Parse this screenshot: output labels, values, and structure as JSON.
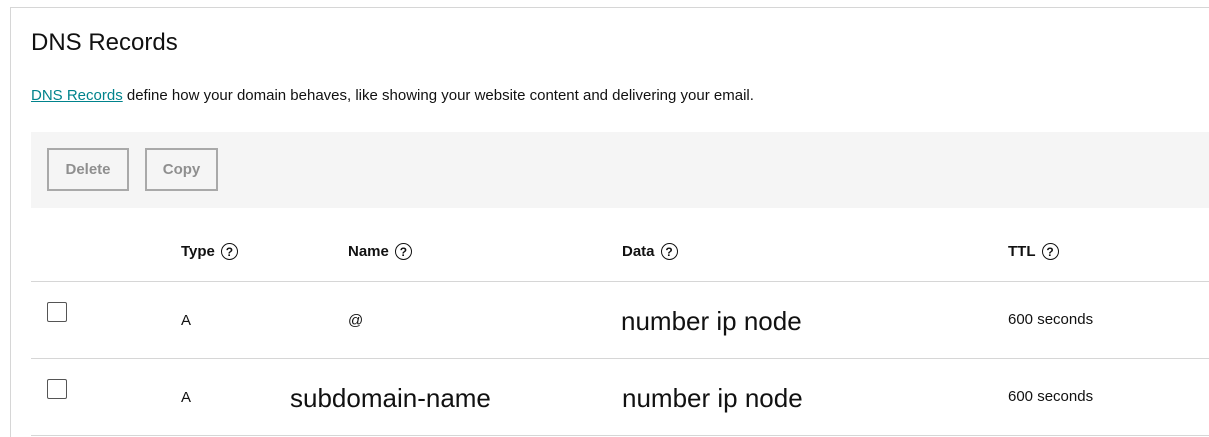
{
  "page": {
    "title": "DNS Records",
    "intro_link": "DNS Records",
    "intro_text": " define how your domain behaves, like showing your website content and delivering your email."
  },
  "toolbar": {
    "delete_label": "Delete",
    "copy_label": "Copy"
  },
  "table": {
    "columns": [
      {
        "label": "Type",
        "help": "?"
      },
      {
        "label": "Name",
        "help": "?"
      },
      {
        "label": "Data",
        "help": "?"
      },
      {
        "label": "TTL",
        "help": "?"
      }
    ],
    "rows": [
      {
        "type": "A",
        "name": "@",
        "data": "number ip node",
        "ttl": "600 seconds"
      },
      {
        "type": "A",
        "name": "subdomain-name",
        "data": "number ip node",
        "ttl": "600 seconds"
      }
    ]
  }
}
